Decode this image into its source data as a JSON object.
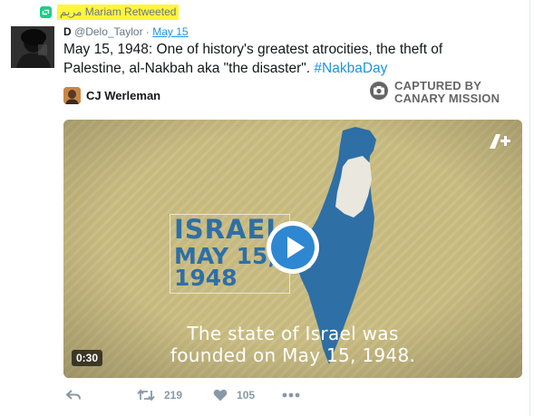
{
  "retweet": {
    "text": "مريم Mariam Retweeted",
    "highlight": "#fff53a"
  },
  "tweet": {
    "name": "D",
    "handle": "@Delo_Taylor",
    "separator": "·",
    "date": "May 15",
    "text_line1": "May 15, 1948: One of history's greatest atrocities, the theft of",
    "text_line2": "Palestine, al-Nakbah aka \"the disaster\".",
    "hashtag": "#NakbaDay"
  },
  "quoted": {
    "author": "CJ Werleman"
  },
  "watermark": {
    "line1": "CAPTURED BY",
    "line2": "CANARY MISSION"
  },
  "video": {
    "israel_line1": "ISRAEL",
    "israel_line2": "MAY 15,",
    "israel_line3": "1948",
    "caption_line1": "The state of Israel was",
    "caption_line2": "founded on May 15, 1948.",
    "duration": "0:30",
    "logo": "AJ+"
  },
  "actions": {
    "retweets": "219",
    "likes": "105"
  },
  "colors": {
    "link": "#1b95e0",
    "map_blue": "#2e6fa6",
    "video_bg": "#c9bc83",
    "retweet_green": "#19cf86"
  },
  "icons": [
    "retweet-icon",
    "camera-icon",
    "play-icon",
    "reply-icon",
    "retweet-action-icon",
    "heart-icon",
    "more-icon"
  ]
}
